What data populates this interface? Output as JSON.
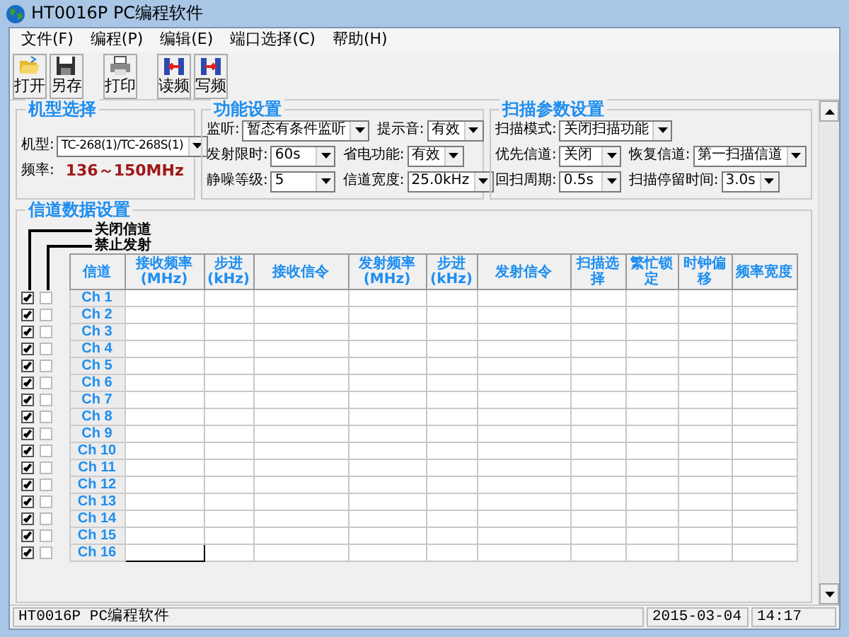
{
  "window": {
    "title": "HT0016P PC编程软件"
  },
  "menu": [
    "文件(F)",
    "编程(P)",
    "编辑(E)",
    "端口选择(C)",
    "帮助(H)"
  ],
  "toolbar": [
    {
      "kind": "open",
      "label": "打开"
    },
    {
      "kind": "save",
      "label": "另存"
    },
    {
      "kind": "print",
      "label": "打印"
    },
    {
      "kind": "read",
      "label": "读频"
    },
    {
      "kind": "write",
      "label": "写频"
    }
  ],
  "model_group": {
    "title": "机型选择",
    "model_label": "机型:",
    "model_value": "TC-268(1)/TC-268S(1)",
    "freq_label": "频率:",
    "freq_value": "136～150MHz"
  },
  "function_group": {
    "title": "功能设置",
    "rows": [
      [
        {
          "label": "监听:",
          "value": "暂态有条件监听"
        },
        {
          "label": "提示音:",
          "value": "有效"
        }
      ],
      [
        {
          "label": "发射限时:",
          "value": "60s"
        },
        {
          "label": "省电功能:",
          "value": "有效"
        }
      ],
      [
        {
          "label": "静噪等级:",
          "value": "5"
        },
        {
          "label": "信道宽度:",
          "value": "25.0kHz"
        }
      ]
    ]
  },
  "scan_group": {
    "title": "扫描参数设置",
    "rows": [
      [
        {
          "label": "扫描模式:",
          "value": "关闭扫描功能"
        }
      ],
      [
        {
          "label": "优先信道:",
          "value": "关闭"
        },
        {
          "label": "恢复信道:",
          "value": "第一扫描信道"
        }
      ],
      [
        {
          "label": "回扫周期:",
          "value": "0.5s"
        },
        {
          "label": "扫描停留时间:",
          "value": "3.0s"
        }
      ]
    ]
  },
  "channel_group": {
    "title": "信道数据设置",
    "legend_close": "关闭信道",
    "legend_tx": "禁止发射",
    "columns": [
      {
        "label": "信道"
      },
      {
        "label": "接收频率",
        "unit": "(MHz)"
      },
      {
        "label": "步进",
        "unit": "(kHz)"
      },
      {
        "label": "接收信令"
      },
      {
        "label": "发射频率",
        "unit": "(MHz)"
      },
      {
        "label": "步进",
        "unit": "(kHz)"
      },
      {
        "label": "发射信令"
      },
      {
        "label": "扫描选择"
      },
      {
        "label": "繁忙锁定"
      },
      {
        "label": "时钟偏移"
      },
      {
        "label": "频率宽度"
      }
    ],
    "rows": [
      {
        "label": "Ch 1",
        "closed": true,
        "tx_disabled": false,
        "focused": false
      },
      {
        "label": "Ch 2",
        "closed": true,
        "tx_disabled": false,
        "focused": false
      },
      {
        "label": "Ch 3",
        "closed": true,
        "tx_disabled": false,
        "focused": false
      },
      {
        "label": "Ch 4",
        "closed": true,
        "tx_disabled": false,
        "focused": false
      },
      {
        "label": "Ch 5",
        "closed": true,
        "tx_disabled": false,
        "focused": false
      },
      {
        "label": "Ch 6",
        "closed": true,
        "tx_disabled": false,
        "focused": false
      },
      {
        "label": "Ch 7",
        "closed": true,
        "tx_disabled": false,
        "focused": false
      },
      {
        "label": "Ch 8",
        "closed": true,
        "tx_disabled": false,
        "focused": false
      },
      {
        "label": "Ch 9",
        "closed": true,
        "tx_disabled": false,
        "focused": false
      },
      {
        "label": "Ch 10",
        "closed": true,
        "tx_disabled": false,
        "focused": false
      },
      {
        "label": "Ch 11",
        "closed": true,
        "tx_disabled": false,
        "focused": false
      },
      {
        "label": "Ch 12",
        "closed": true,
        "tx_disabled": false,
        "focused": false
      },
      {
        "label": "Ch 13",
        "closed": true,
        "tx_disabled": false,
        "focused": false
      },
      {
        "label": "Ch 14",
        "closed": true,
        "tx_disabled": false,
        "focused": false
      },
      {
        "label": "Ch 15",
        "closed": true,
        "tx_disabled": false,
        "focused": false
      },
      {
        "label": "Ch 16",
        "closed": true,
        "tx_disabled": false,
        "focused": true
      }
    ]
  },
  "status_bar": [
    "HT0016P PC编程软件",
    "2015-03-04",
    "14:17"
  ]
}
